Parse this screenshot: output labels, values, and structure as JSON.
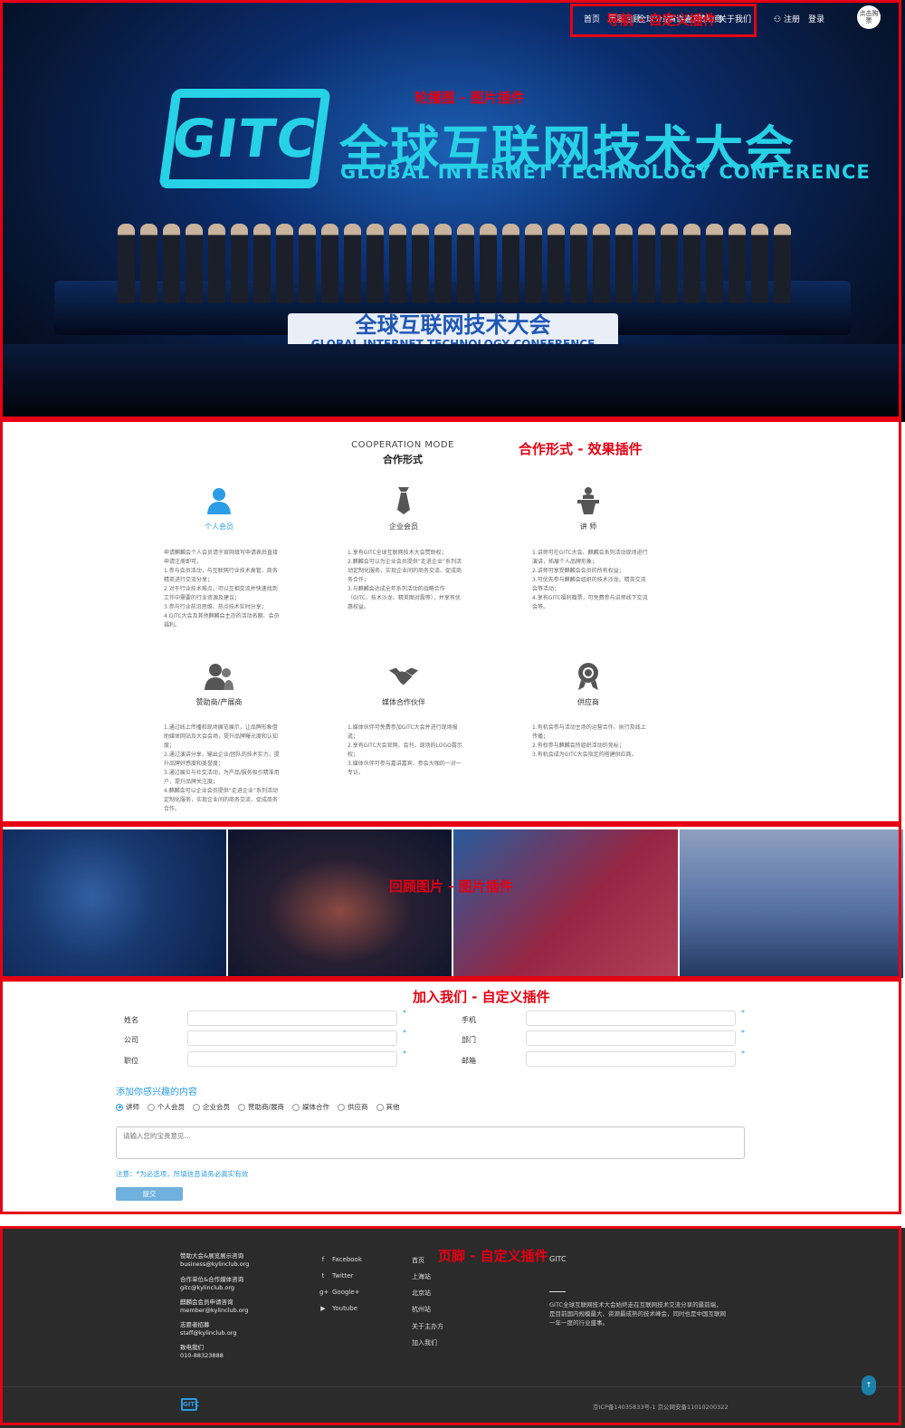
{
  "nav": {
    "items": [
      "首页",
      "历届回顾",
      "全球分站",
      "演讲嘉宾",
      "赞助商",
      "关于我们"
    ],
    "register": "注册",
    "login": "登录",
    "cart": "点击购票"
  },
  "hero": {
    "logo_text": "GITC",
    "title_cn": "全球互联网技术大会",
    "title_en": "GLOBAL INTERNET TECHNOLOGY CONFERENCE"
  },
  "cooperation": {
    "title_en": "COOPERATION MODE",
    "title_cn": "合作形式",
    "cards": [
      {
        "name": "个人会员",
        "icon": "person-icon",
        "desc": "申请麒麟会个人会员请于官网填写申请表后直接申请注册即可。\n1.参与会员活动，与互联网行业技术高管、商务精英进行交流分享；\n2.对于行业技术难点，可以互相交流并快速找到工作中需要的行业资源及建议；\n3.参与行业前沿思维、热点技术实时分享；\n4.GITC大会及其他麒麟会主办的活动名额、会员福利。"
      },
      {
        "name": "企业会员",
        "icon": "tie-icon",
        "desc": "1.享有GITC全球互联网技术大会赞助权；\n2.麒麟会可以为企业会员提供“走进企业”系列活动定制化服务，实现企业间的商务交流、促成商务合作；\n3.与麒麟会达成全年系列活动的战略合作（GITC、技术沙龙、精英图对震等），并享有优惠权益。"
      },
      {
        "name": "讲 师",
        "icon": "speaker-icon",
        "desc": "1.讲师可在GITC大会、麒麟会系列活动现场进行演讲，拓展个人品牌形象；\n2.讲师可享受麒麟会会员的所有权益；\n3.可优先参与麒麟会组织的技术沙龙、精英交流会等活动；\n4.享有GITC福利赠票，可免费参与讲师线下交流会等。"
      },
      {
        "name": "赞助商/产展商",
        "icon": "group-icon",
        "desc": "1.通过线上传播和现场展览展示，让品牌形象借助媒体网站及大会会场，提升品牌曝光度和认知度；\n2.通过演讲分享，输出企业/团队的技术实力，提升品牌好感度和美誉度；\n3.通过展位与社交活动，为产品/服务吸引精准用户，提升品牌关注度；\n4.麒麟会可以企业会员提供“走进企业”系列活动定制化服务，实现企业间的商务交流、促成商务合作。"
      },
      {
        "name": "媒体合作伙伴",
        "icon": "handshake-icon",
        "desc": "1.媒体伙伴可免费参加GITC大会并进行现场报道；\n2.享有GITC大会官网、会刊、现场的LOGO露示权；\n3.媒体伙伴可参与嘉讲嘉宾、参会大咖的一对一专访。"
      },
      {
        "name": "供应商",
        "icon": "badge-icon",
        "desc": "1.有机会参与活动主场的运营合作、执行及线上传播；\n2.有权参与麒麟会所组织活动的竞标；\n3.有机会成为GITC大会指定的搭建供应商。"
      }
    ]
  },
  "join": {
    "fields_left": [
      {
        "label": "姓名",
        "required": "*"
      },
      {
        "label": "公司",
        "required": "*"
      },
      {
        "label": "职位",
        "required": "*"
      }
    ],
    "fields_right": [
      {
        "label": "手机",
        "required": "*"
      },
      {
        "label": "部门",
        "required": "*"
      },
      {
        "label": "邮箱",
        "required": "*"
      }
    ],
    "interest_title": "添加你感兴趣的内容",
    "options": [
      "讲师",
      "个人会员",
      "企业会员",
      "赞助商/展商",
      "媒体合作",
      "供应商",
      "其他"
    ],
    "selected": "讲师",
    "textarea_placeholder": "请输入您的宝贵意见...",
    "note": "注意：*为必选项，所填信息请务必真实有效",
    "submit": "提交"
  },
  "footer": {
    "contacts": [
      {
        "title": "赞助大会&展览展示咨询",
        "value": "business@kylinclub.org"
      },
      {
        "title": "合作单位&合作媒体咨询",
        "value": "gitc@kylinclub.org"
      },
      {
        "title": "麒麟会会员申请咨询",
        "value": "member@kylinclub.org"
      },
      {
        "title": "志愿者招募",
        "value": "staff@kylinclub.org"
      },
      {
        "title": "致电我们",
        "value": "010-88323888"
      }
    ],
    "social": [
      {
        "icon": "facebook-icon",
        "label": "Facebook",
        "glyph": "f"
      },
      {
        "icon": "twitter-icon",
        "label": "Twitter",
        "glyph": "t"
      },
      {
        "icon": "googleplus-icon",
        "label": "Google+",
        "glyph": "g+"
      },
      {
        "icon": "youtube-icon",
        "label": "Youtube",
        "glyph": "▶"
      }
    ],
    "links": [
      "首页",
      "上海站",
      "北京站",
      "杭州站",
      "关于主办方",
      "加入我们"
    ],
    "gitc_head": "GITC",
    "gitc_desc": "GITC全球互联网技术大会始终走在互联网技术交流分享的最前端，是目前国内规模最大、资源最成熟的技术峰会，同时也是中国互联网一年一度的行业盛事。",
    "icp": "京ICP备14035833号-1  京公网安备11010200322",
    "logo_text": "GITC",
    "totop": "↑"
  },
  "annotations": {
    "nav": "导航 - 自定义插件",
    "hero": "轮播图 - 图片插件",
    "coop": "合作形式 - 效果插件",
    "gallery": "回顾图片 - 图片插件",
    "join": "加入我们 - 自定义插件",
    "footer": "页脚 - 自定义插件"
  },
  "colors": {
    "accent": "#2b9de6",
    "annotation": "#e60012",
    "footer_bg": "#2b2b2b"
  }
}
